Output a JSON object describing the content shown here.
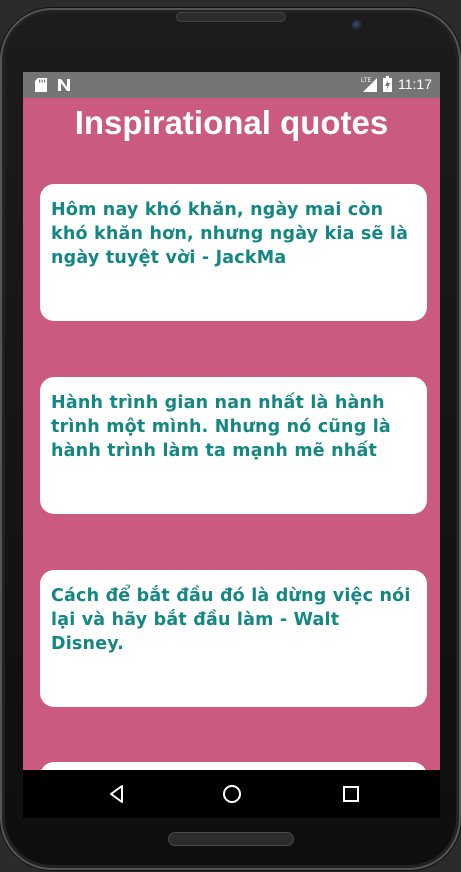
{
  "status_bar": {
    "time": "11:17",
    "network_label": "LTE",
    "icons": [
      "sd-card-icon",
      "notification-n-icon",
      "signal-icon",
      "battery-icon"
    ]
  },
  "app": {
    "title": "Inspirational quotes",
    "background_color": "#cb5a80",
    "quote_text_color": "#148783"
  },
  "quotes": [
    {
      "text": "Hôm nay khó khăn, ngày mai còn khó khăn hơn, nhưng ngày kia sẽ là ngày tuyệt vời - JackMa"
    },
    {
      "text": "Hành trình gian nan nhất là hành trình một mình. Nhưng nó cũng là hành trình làm ta mạnh mẽ nhất"
    },
    {
      "text": "Cách để bắt đầu đó là dừng việc nói lại và hãy bắt đầu làm - Walt Disney."
    },
    {
      "text": ""
    }
  ],
  "nav_bar": {
    "buttons": [
      "back-icon",
      "home-icon",
      "recents-icon"
    ]
  }
}
